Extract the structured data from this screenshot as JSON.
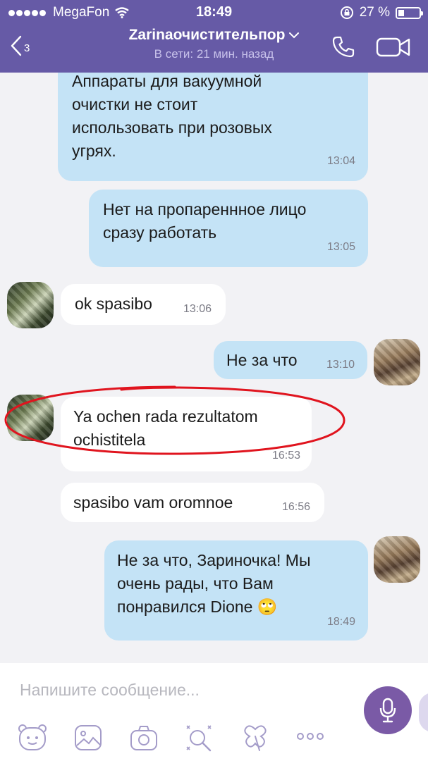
{
  "status_bar": {
    "carrier": "MegaFon",
    "time": "18:49",
    "battery": "27 %"
  },
  "header": {
    "back_count": "3",
    "contact_name": "Zarinaочистительпор",
    "presence": "В сети: 21 мин. назад"
  },
  "messages": [
    {
      "direction": "outgoing",
      "text": "Аппараты для вакуумной\nочистки не стоит\nиспользовать при розовых\nугрях.",
      "time": "13:04"
    },
    {
      "direction": "outgoing",
      "text": "Нет на пропареннное лицо\nсразу работать",
      "time": "13:05"
    },
    {
      "direction": "incoming",
      "text": "ok spasibo",
      "time": "13:06"
    },
    {
      "direction": "outgoing",
      "text": "Не за что",
      "time": "13:10"
    },
    {
      "direction": "incoming",
      "text": "Ya ochen rada rezultatom\nochistitela",
      "time": "16:53"
    },
    {
      "direction": "incoming",
      "text": "spasibo vam oromnoe",
      "time": "16:56"
    },
    {
      "direction": "outgoing",
      "text": "Не за что, Зариночка! Мы\nочень рады, что Вам\nпонравился Dione",
      "emoji": "🙄",
      "time": "18:49"
    }
  ],
  "composer": {
    "placeholder": "Напишите сообщение..."
  },
  "toolbar": [
    "sticker-icon",
    "gallery-icon",
    "camera-icon",
    "doodle-icon",
    "gif-icon",
    "more-icon"
  ],
  "colors": {
    "header_bg": "#665aa6",
    "outgoing_bubble": "#c4e3f6",
    "incoming_bubble": "#ffffff",
    "chat_bg": "#f2f2f5",
    "mic_button": "#7a5aa6",
    "annotation": "#e0141e"
  }
}
